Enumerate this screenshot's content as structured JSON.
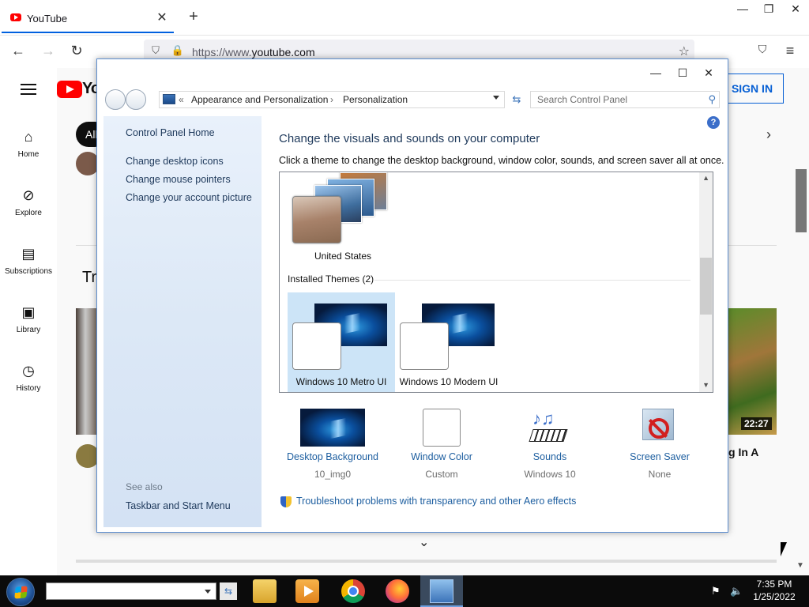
{
  "browser": {
    "tab_title": "YouTube",
    "url_prefix": "https://www.",
    "url_domain": "youtube.com"
  },
  "youtube": {
    "logo_text": "Yo",
    "signin_label": "SIGN IN",
    "chip_label": "All",
    "heading_fragment": "Tr",
    "duration": "22:27",
    "cut_title": "g In A",
    "sidebar": [
      {
        "label": "Home",
        "icon": "home-icon"
      },
      {
        "label": "Explore",
        "icon": "compass-icon"
      },
      {
        "label": "Subscriptions",
        "icon": "subscriptions-icon"
      },
      {
        "label": "Library",
        "icon": "library-icon"
      },
      {
        "label": "History",
        "icon": "history-icon"
      }
    ]
  },
  "control_panel": {
    "breadcrumb": [
      "Appearance and Personalization",
      "Personalization"
    ],
    "breadcrumb_prefix": "«",
    "breadcrumb_sep": "›",
    "search_placeholder": "Search Control Panel",
    "left_links": [
      "Control Panel Home",
      "Change desktop icons",
      "Change mouse pointers",
      "Change your account picture"
    ],
    "see_also_label": "See also",
    "see_also_links": [
      "Taskbar and Start Menu"
    ],
    "title": "Change the visuals and sounds on your computer",
    "subtitle": "Click a theme to change the desktop background, window color, sounds, and screen saver all at once.",
    "themes": {
      "top_theme_name": "United States",
      "installed_group": "Installed Themes (2)",
      "installed": [
        {
          "name": "Windows 10 Metro UI",
          "selected": true
        },
        {
          "name": "Windows 10 Modern UI",
          "selected": false
        }
      ]
    },
    "settings": [
      {
        "label": "Desktop Background",
        "value": "10_img0",
        "icon": "wallpaper-icon"
      },
      {
        "label": "Window Color",
        "value": "Custom",
        "icon": "window-color-icon"
      },
      {
        "label": "Sounds",
        "value": "Windows 10",
        "icon": "music-icon"
      },
      {
        "label": "Screen Saver",
        "value": "None",
        "icon": "screensaver-icon"
      }
    ],
    "troubleshoot_link": "Troubleshoot problems with transparency and other Aero effects",
    "help_glyph": "?"
  },
  "taskbar": {
    "time": "7:35 PM",
    "date": "1/25/2022",
    "apps": [
      "file-explorer-icon",
      "media-player-icon",
      "chrome-icon",
      "firefox-icon",
      "control-panel-icon"
    ]
  },
  "colors": {
    "link": "#1e5fa0",
    "title": "#1e395b",
    "accent": "#065fd4",
    "youtube_red": "#ff0000",
    "selection": "#cce4f7"
  }
}
